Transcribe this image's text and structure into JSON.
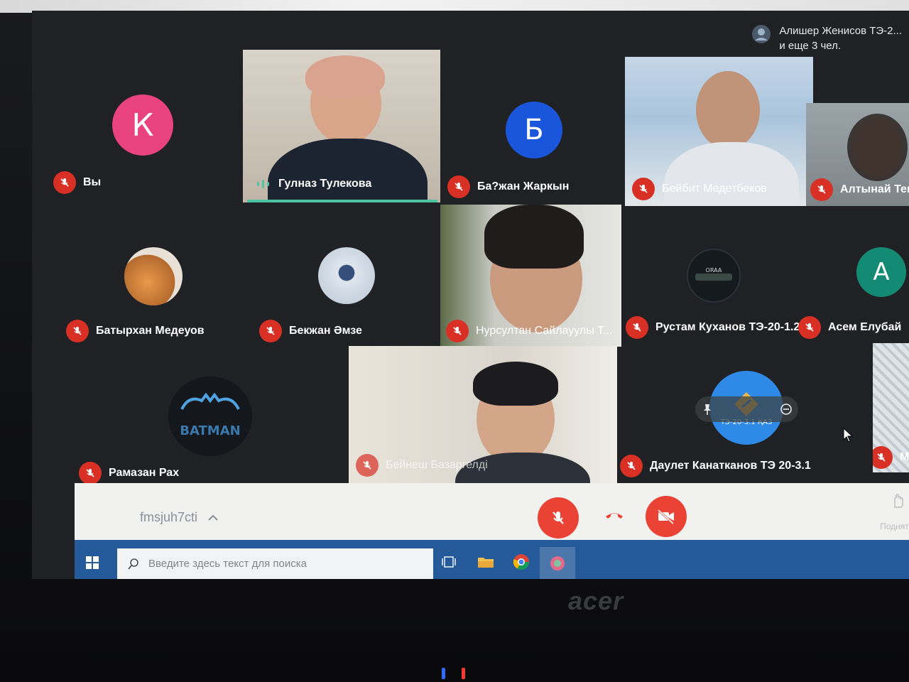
{
  "header": {
    "participants_line1": "Алишер Женисов ТЭ-2...",
    "participants_line2": "и еще 3 чел."
  },
  "tiles": {
    "you": {
      "initial": "К",
      "name": "Вы",
      "avatar_color": "#e8427f"
    },
    "gulnaz": {
      "name": "Гулназ Тулекова"
    },
    "bajan": {
      "initial": "Б",
      "name": "Ба?жан Жаркын",
      "avatar_color": "#1a56db"
    },
    "beibit": {
      "name": "Бейбит Медетбеков"
    },
    "altynai": {
      "name": "Алтынай Тенба"
    },
    "batyrkhan": {
      "name": "Батырхан Медеуов"
    },
    "bekzhan": {
      "name": "Бекжан Әмзе"
    },
    "nursultan": {
      "name": "Нурсултан Сайлауулы Т..."
    },
    "rustam": {
      "name": "Рустам Куханов ТЭ-20-1.2"
    },
    "asem": {
      "initial": "А",
      "name": "Асем Елубай",
      "avatar_color": "#138a73"
    },
    "ramazan": {
      "name": "Рамазан Рах",
      "logo_text": "BATMAN"
    },
    "basargeldi": {
      "name": "Бейнеш Базаргелді"
    },
    "daulet": {
      "name": "Даулет Канатканов ТЭ 20-3.1",
      "avatar_label": "ТЭ-20-3.1 ҚАЗ"
    },
    "partial_right": {
      "name": "Ма"
    }
  },
  "controls": {
    "meeting_code": "fmsjuh7cti",
    "present_label": "Поднять"
  },
  "taskbar": {
    "search_placeholder": "Введите здесь текст для поиска"
  },
  "laptop": {
    "brand": "acer"
  },
  "colors": {
    "accent_red": "#ea4335",
    "taskbar_blue": "#245a99",
    "meet_bg": "#202124"
  }
}
